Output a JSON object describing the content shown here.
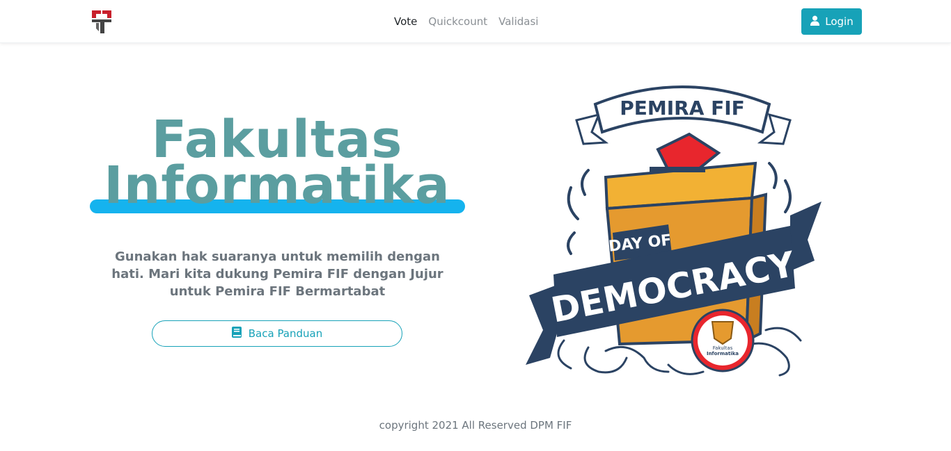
{
  "nav": {
    "links": [
      "Vote",
      "Quickcount",
      "Validasi"
    ],
    "login_label": "Login"
  },
  "hero": {
    "title_line1": "Fakultas",
    "title_line2": "Informatika",
    "tagline": "Gunakan hak suaranya untuk memilih dengan hati. Mari kita dukung Pemira FIF dengan Jujur untuk Pemira FIF Bermartabat",
    "guide_label": "Baca Panduan"
  },
  "illustration": {
    "banner_text": "PEMIRA FIF",
    "day_of": "DAY OF",
    "democracy": "DEMOCRACY",
    "badge_line1": "Fakultas",
    "badge_line2": "Informatika"
  },
  "footer": {
    "text": "copyright 2021 All Reserved DPM FIF"
  },
  "colors": {
    "accent": "#17a2b8",
    "title": "#5b9ea0",
    "underline": "#15b3ee",
    "navy": "#2b4363",
    "box": "#e59a2f",
    "ballot": "#e8262d"
  }
}
